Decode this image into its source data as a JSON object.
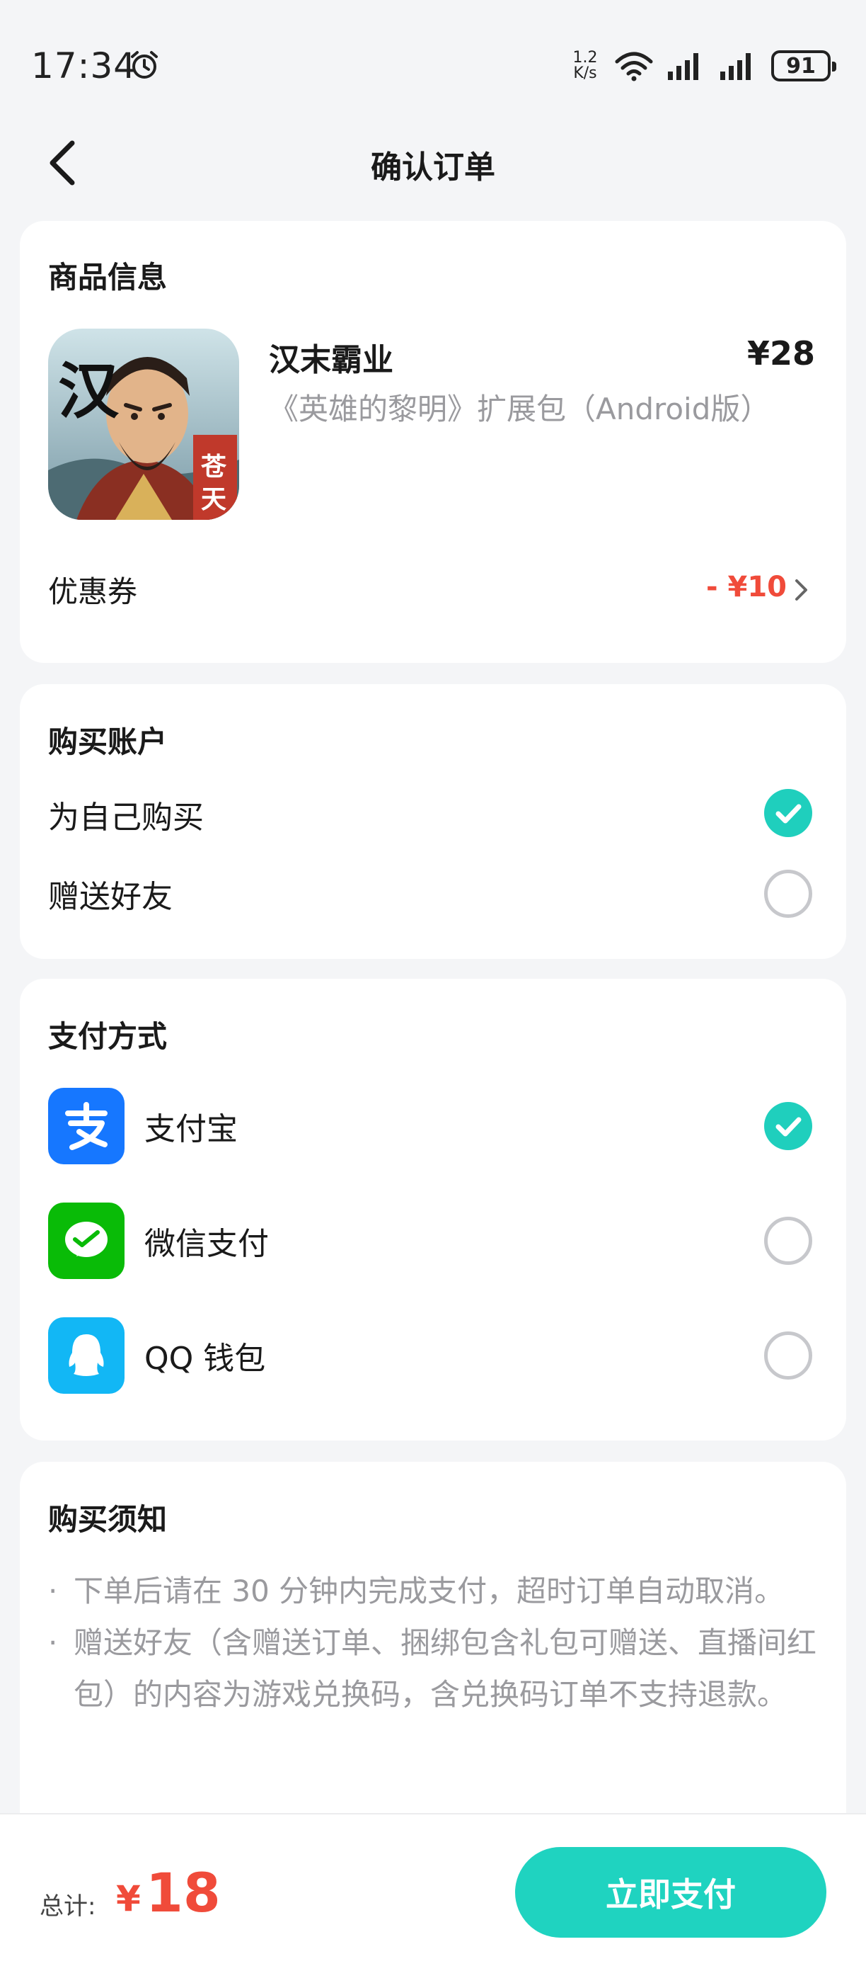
{
  "status_bar": {
    "time": "17:34",
    "net_speed_value": "1.2",
    "net_speed_unit": "K/s",
    "battery": "91"
  },
  "navbar": {
    "title": "确认订单"
  },
  "product": {
    "section_title": "商品信息",
    "name": "汉末霸业",
    "price": "¥28",
    "description": "《英雄的黎明》扩展包（Android版）",
    "icon_glyph_main": "汉",
    "icon_glyph_side_1": "苍",
    "icon_glyph_side_2": "天",
    "coupon_label": "优惠券",
    "coupon_value": "- ¥10"
  },
  "account": {
    "section_title": "购买账户",
    "options": [
      {
        "label": "为自己购买",
        "selected": true
      },
      {
        "label": "赠送好友",
        "selected": false
      }
    ]
  },
  "payment": {
    "section_title": "支付方式",
    "methods": [
      {
        "label": "支付宝",
        "icon": "alipay-icon",
        "color": "#1677ff",
        "selected": true
      },
      {
        "label": "微信支付",
        "icon": "wechat-pay-icon",
        "color": "#09bb07",
        "selected": false
      },
      {
        "label": "QQ 钱包",
        "icon": "qq-wallet-icon",
        "color": "#12b7f5",
        "selected": false
      }
    ]
  },
  "notice": {
    "section_title": "购买须知",
    "items": [
      "下单后请在 30 分钟内完成支付，超时订单自动取消。",
      "赠送好友（含赠送订单、捆绑包含礼包可赠送、直播间红包）的内容为游戏兑换码，含兑换码订单不支持退款。"
    ]
  },
  "footer": {
    "total_label": "总计:",
    "currency": "¥",
    "total_amount": "18",
    "pay_button": "立即支付"
  },
  "colors": {
    "accent": "#1fd3c0",
    "price_red": "#f04b3a",
    "muted_text": "#9a9a9e",
    "background": "#f4f5f7"
  }
}
